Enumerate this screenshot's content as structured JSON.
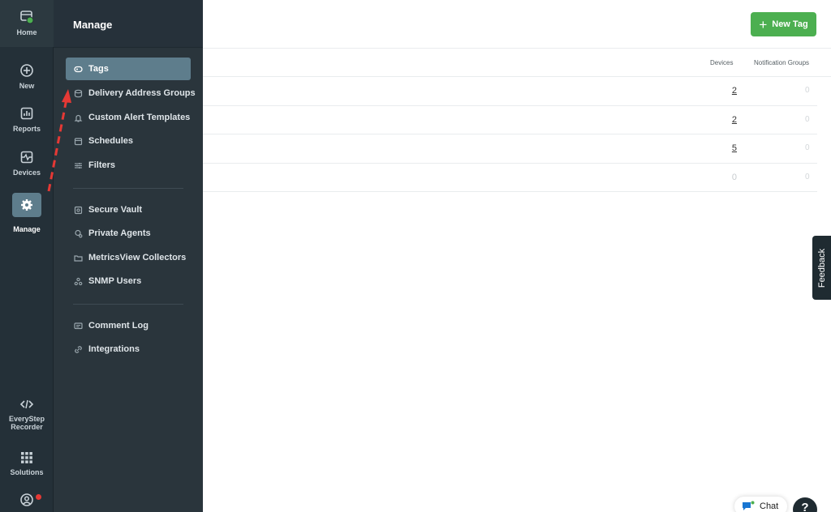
{
  "rail": {
    "home": "Home",
    "new": "New",
    "reports": "Reports",
    "devices": "Devices",
    "manage": "Manage",
    "everystep": "EveryStep Recorder",
    "solutions": "Solutions"
  },
  "panel": {
    "title": "Manage",
    "items": [
      {
        "label": "Tags",
        "icon": "tag-icon"
      },
      {
        "label": "Delivery Address Groups",
        "icon": "stack-icon"
      },
      {
        "label": "Custom Alert Templates",
        "icon": "bell-icon"
      },
      {
        "label": "Schedules",
        "icon": "calendar-icon"
      },
      {
        "label": "Filters",
        "icon": "filter-icon"
      },
      {
        "label": "Secure Vault",
        "icon": "vault-icon"
      },
      {
        "label": "Private Agents",
        "icon": "agent-icon"
      },
      {
        "label": "MetricsView Collectors",
        "icon": "folder-icon"
      },
      {
        "label": "SNMP Users",
        "icon": "users-icon"
      },
      {
        "label": "Comment Log",
        "icon": "comment-icon"
      },
      {
        "label": "Integrations",
        "icon": "link-icon"
      }
    ]
  },
  "toolbar": {
    "new_tag": "New Tag"
  },
  "table": {
    "columns": [
      "Devices",
      "Notification Groups"
    ],
    "rows": [
      {
        "devices": "2",
        "notification_groups": "0"
      },
      {
        "devices": "2",
        "notification_groups": "0"
      },
      {
        "devices": "5",
        "notification_groups": "0"
      },
      {
        "devices": "0",
        "notification_groups": "0"
      }
    ]
  },
  "feedback": "Feedback",
  "chat": "Chat",
  "help": "?",
  "colors": {
    "rail_bg": "#243038",
    "panel_bg": "#2a353c",
    "active_item": "#5e7d8c",
    "primary_green": "#4caf50",
    "annotation_arrow": "#e53935"
  }
}
